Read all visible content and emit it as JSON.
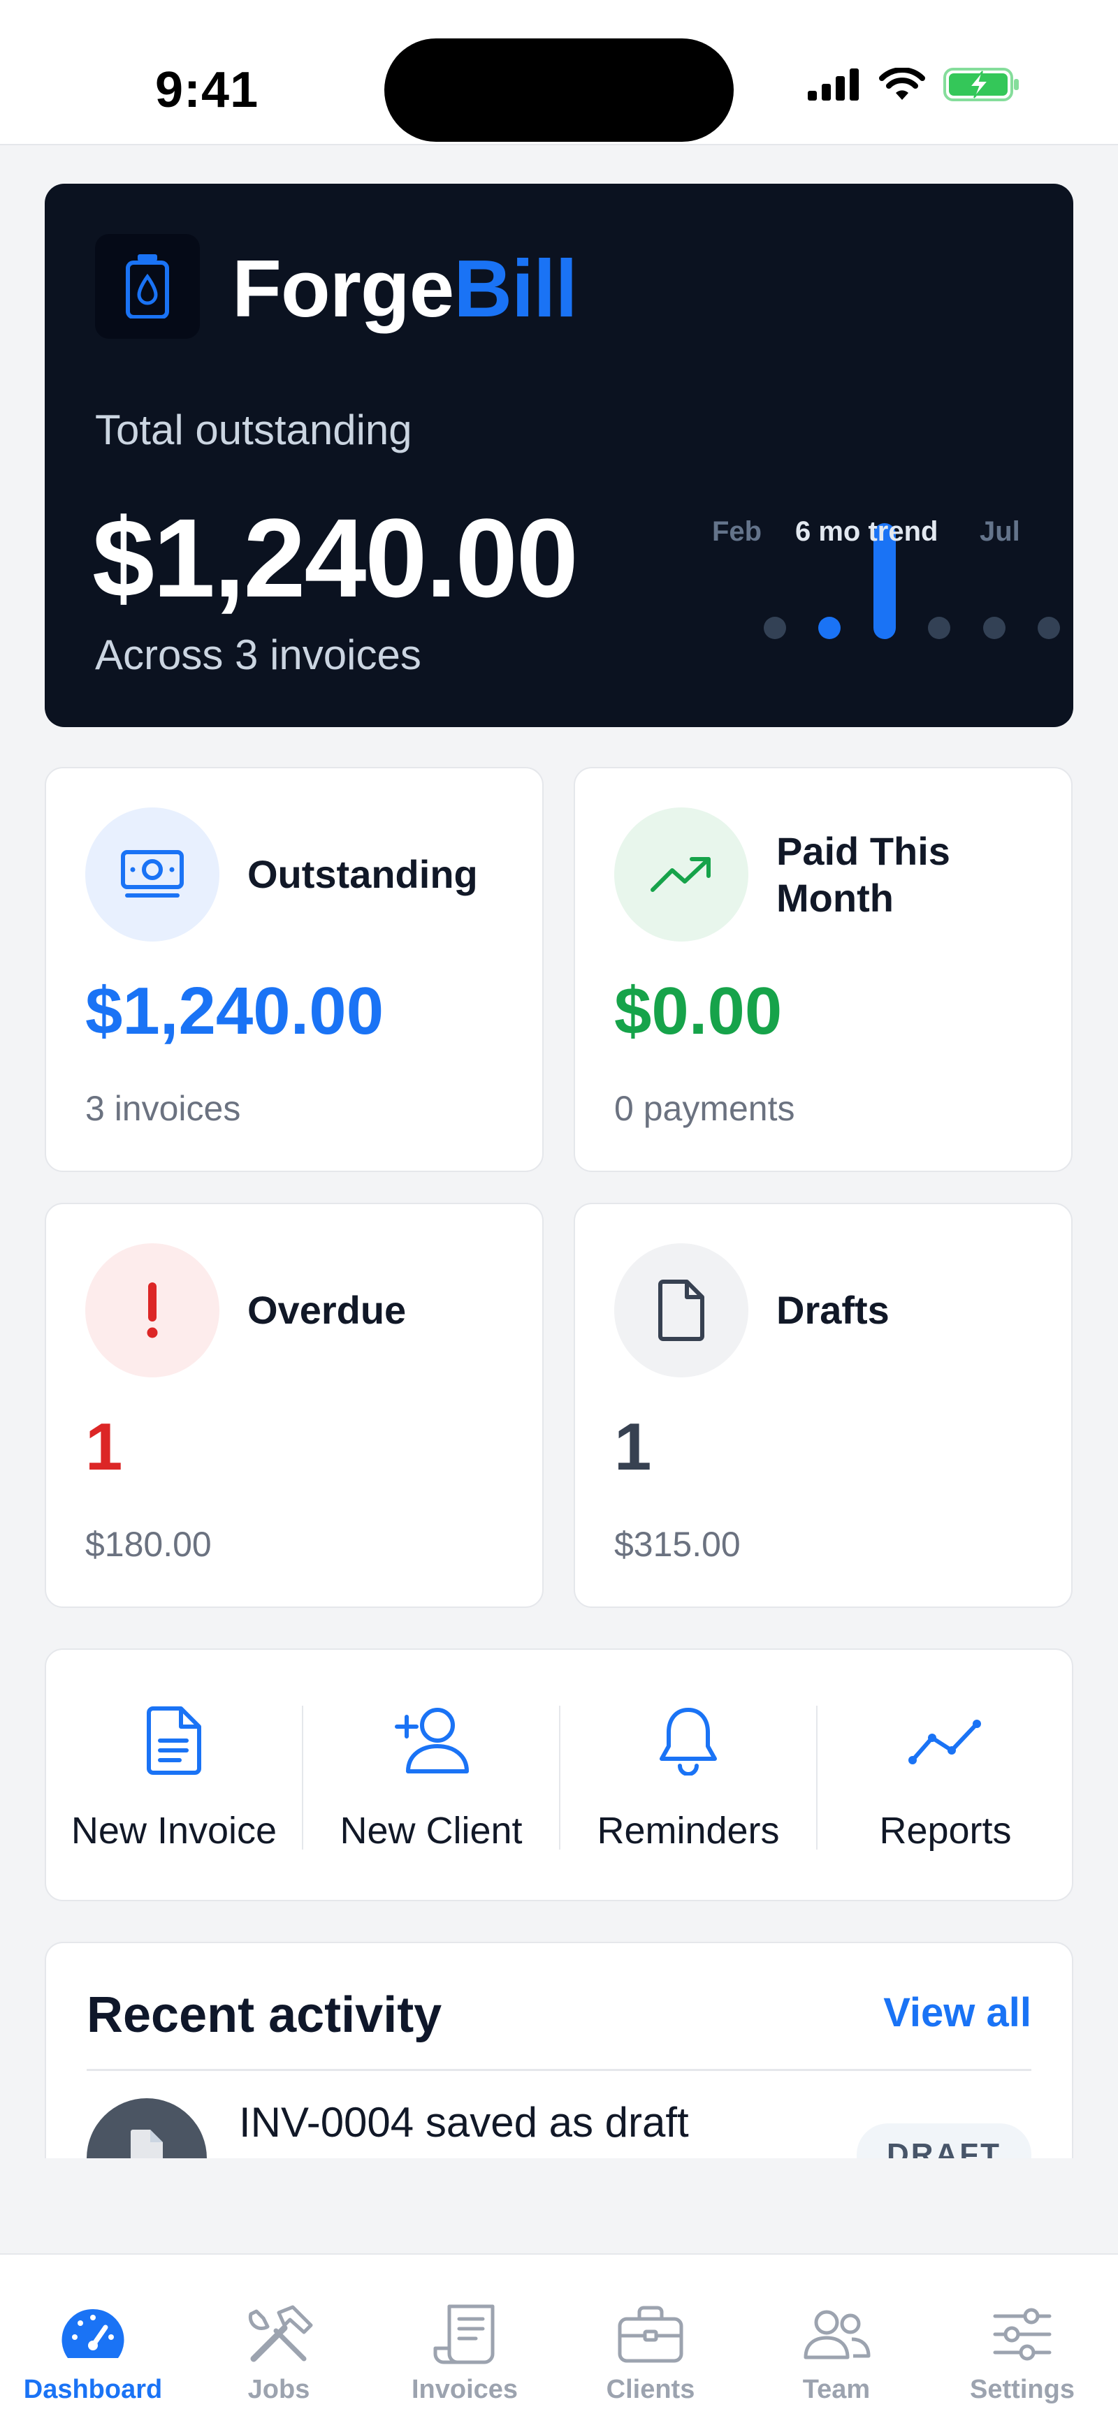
{
  "status_bar": {
    "time": "9:41"
  },
  "hero": {
    "brand_part1": "Forge",
    "brand_part2": "Bill",
    "label": "Total outstanding",
    "amount": "$1,240.00",
    "subtitle": "Across 3 invoices",
    "trend": {
      "start_label": "Feb",
      "middle_label": "6 mo trend",
      "end_label": "Jul",
      "values": [
        0,
        60,
        1240,
        0,
        0,
        0
      ]
    }
  },
  "stats": [
    {
      "title": "Outstanding",
      "value": "$1,240.00",
      "sub": "3 invoices",
      "icon": "cash-icon",
      "color": "#1a73f5",
      "bg": "#e8f0fe"
    },
    {
      "title": "Paid This Month",
      "value": "$0.00",
      "sub": "0 payments",
      "icon": "trending-up-icon",
      "color": "#16a34a",
      "bg": "#e8f6ec"
    },
    {
      "title": "Overdue",
      "value": "1",
      "sub": "$180.00",
      "icon": "alert-icon",
      "color": "#dc2626",
      "bg": "#fdecec"
    },
    {
      "title": "Drafts",
      "value": "1",
      "sub": "$315.00",
      "icon": "document-icon",
      "color": "#374151",
      "bg": "#f1f2f4"
    }
  ],
  "actions": [
    {
      "label": "New Invoice",
      "icon": "new-invoice-icon"
    },
    {
      "label": "New Client",
      "icon": "add-user-icon"
    },
    {
      "label": "Reminders",
      "icon": "bell-icon"
    },
    {
      "label": "Reports",
      "icon": "chart-line-icon"
    }
  ],
  "activity": {
    "title": "Recent activity",
    "view_all": "View all",
    "items": [
      {
        "text": "INV-0004 saved as draft",
        "badge": "DRAFT",
        "icon": "document-icon"
      }
    ]
  },
  "tabs": [
    {
      "label": "Dashboard",
      "icon": "gauge-icon",
      "active": true
    },
    {
      "label": "Jobs",
      "icon": "tools-icon",
      "active": false
    },
    {
      "label": "Invoices",
      "icon": "receipt-icon",
      "active": false
    },
    {
      "label": "Clients",
      "icon": "briefcase-icon",
      "active": false
    },
    {
      "label": "Team",
      "icon": "team-icon",
      "active": false
    },
    {
      "label": "Settings",
      "icon": "sliders-icon",
      "active": false
    }
  ],
  "colors": {
    "accent": "#1a73f5",
    "hero_bg": "#0b1220",
    "success": "#16a34a",
    "danger": "#dc2626"
  }
}
